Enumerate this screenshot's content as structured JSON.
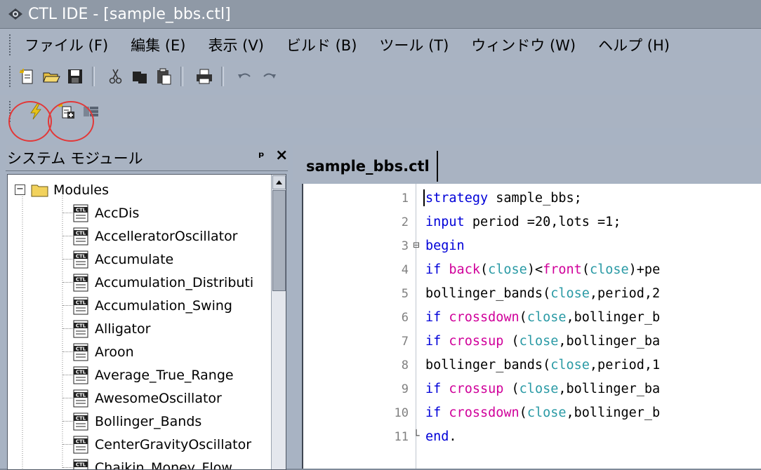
{
  "window": {
    "title": "CTL IDE - [sample_bbs.ctl]"
  },
  "menu": [
    "ファイル (F)",
    "編集 (E)",
    "表示 (V)",
    "ビルド (B)",
    "ツール (T)",
    "ウィンドウ (W)",
    "ヘルプ (H)"
  ],
  "toolbar_main": [
    "new-file-icon",
    "open-folder-icon",
    "save-icon",
    "cut-icon",
    "copy-icon",
    "paste-icon",
    "print-icon",
    "undo-icon",
    "redo-icon"
  ],
  "toolbar_build": [
    "lightning-compile-icon",
    "new-module-icon",
    "module-view-icon"
  ],
  "panel": {
    "title": "システム モジュール",
    "pin": "ᵖ",
    "close": "×",
    "root": "Modules",
    "items": [
      "AccDis",
      "AccelleratorOscillator",
      "Accumulate",
      "Accumulation_Distributi",
      "Accumulation_Swing",
      "Alligator",
      "Aroon",
      "Average_True_Range",
      "AwesomeOscillator",
      "Bollinger_Bands",
      "CenterGravityOscillator",
      "Chaikin_Money_Flow"
    ]
  },
  "editor": {
    "tab": "sample_bbs.ctl",
    "lines": [
      {
        "num": "1",
        "fold": "",
        "parts": [
          [
            "strategy",
            "blue"
          ],
          [
            " sample_bbs;",
            "black"
          ]
        ]
      },
      {
        "num": "2",
        "fold": "",
        "parts": [
          [
            "input",
            "blue"
          ],
          [
            " period =20,lots =1;",
            "black"
          ]
        ]
      },
      {
        "num": "3",
        "fold": "⊟",
        "parts": [
          [
            "begin",
            "blue"
          ]
        ]
      },
      {
        "num": "4",
        "fold": "",
        "parts": [
          [
            "if",
            "blue"
          ],
          [
            " ",
            "black"
          ],
          [
            "back",
            "pink"
          ],
          [
            "(",
            "black"
          ],
          [
            "close",
            "teal"
          ],
          [
            ")<",
            "black"
          ],
          [
            "front",
            "pink"
          ],
          [
            "(",
            "black"
          ],
          [
            "close",
            "teal"
          ],
          [
            ")+pe",
            "black"
          ]
        ]
      },
      {
        "num": "5",
        "fold": "",
        "parts": [
          [
            "bollinger_bands(",
            "black"
          ],
          [
            "close",
            "teal"
          ],
          [
            ",period,2",
            "black"
          ]
        ]
      },
      {
        "num": "6",
        "fold": "",
        "parts": [
          [
            "if",
            "blue"
          ],
          [
            " ",
            "black"
          ],
          [
            "crossdown",
            "pink"
          ],
          [
            "(",
            "black"
          ],
          [
            "close",
            "teal"
          ],
          [
            ",bollinger_b",
            "black"
          ]
        ]
      },
      {
        "num": "7",
        "fold": "",
        "parts": [
          [
            "if",
            "blue"
          ],
          [
            " ",
            "black"
          ],
          [
            "crossup",
            "pink"
          ],
          [
            " (",
            "black"
          ],
          [
            "close",
            "teal"
          ],
          [
            ",bollinger_ba",
            "black"
          ]
        ]
      },
      {
        "num": "8",
        "fold": "",
        "parts": [
          [
            "bollinger_bands(",
            "black"
          ],
          [
            "close",
            "teal"
          ],
          [
            ",period,1",
            "black"
          ]
        ]
      },
      {
        "num": "9",
        "fold": "",
        "parts": [
          [
            "if",
            "blue"
          ],
          [
            " ",
            "black"
          ],
          [
            "crossup",
            "pink"
          ],
          [
            " (",
            "black"
          ],
          [
            "close",
            "teal"
          ],
          [
            ",bollinger_ba",
            "black"
          ]
        ]
      },
      {
        "num": "10",
        "fold": "",
        "parts": [
          [
            "if",
            "blue"
          ],
          [
            " ",
            "black"
          ],
          [
            "crossdown",
            "pink"
          ],
          [
            "(",
            "black"
          ],
          [
            "close",
            "teal"
          ],
          [
            ",bollinger_b",
            "black"
          ]
        ]
      },
      {
        "num": "11",
        "fold": "└",
        "parts": [
          [
            "end",
            "blue"
          ],
          [
            ".",
            "black"
          ]
        ]
      }
    ]
  },
  "colors": {
    "keyword": "#0000d8",
    "function": "#d0009a",
    "variable": "#2a9aa5",
    "highlight_ring": "#e23838"
  }
}
